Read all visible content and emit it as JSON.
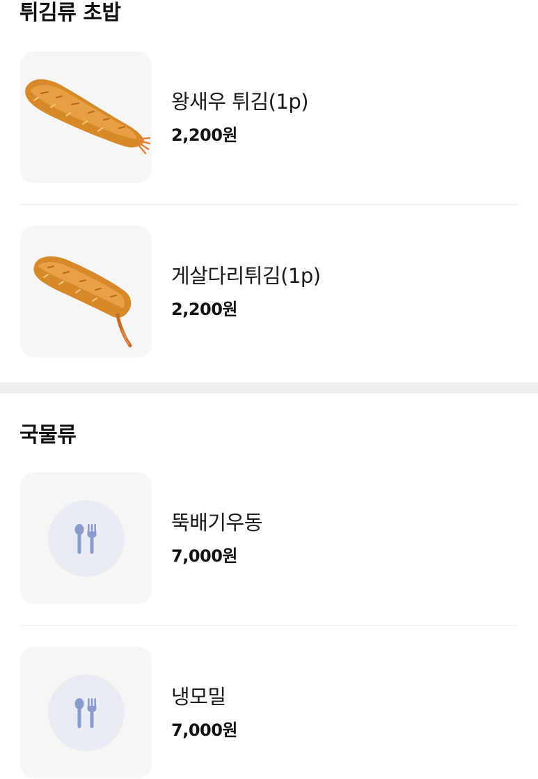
{
  "sections": [
    {
      "title": "튀김류 초밥",
      "items": [
        {
          "name": "왕새우 튀김(1p)",
          "price": "2,200원",
          "image_icon": "fried-shrimp-photo"
        },
        {
          "name": "게살다리튀김(1p)",
          "price": "2,200원",
          "image_icon": "fried-crab-leg-photo"
        }
      ]
    },
    {
      "title": "국물류",
      "items": [
        {
          "name": "뚝배기우동",
          "price": "7,000원",
          "image_icon": "spoon-fork-icon"
        },
        {
          "name": "냉모밀",
          "price": "7,000원",
          "image_icon": "spoon-fork-icon"
        }
      ]
    }
  ],
  "colors": {
    "section_gap": "#eeeeee",
    "thumbnail_bg": "#f6f6f6",
    "placeholder_circle": "#e9edf3",
    "placeholder_icon": "#8a9bcf",
    "fried_batter": "#d8892a"
  }
}
